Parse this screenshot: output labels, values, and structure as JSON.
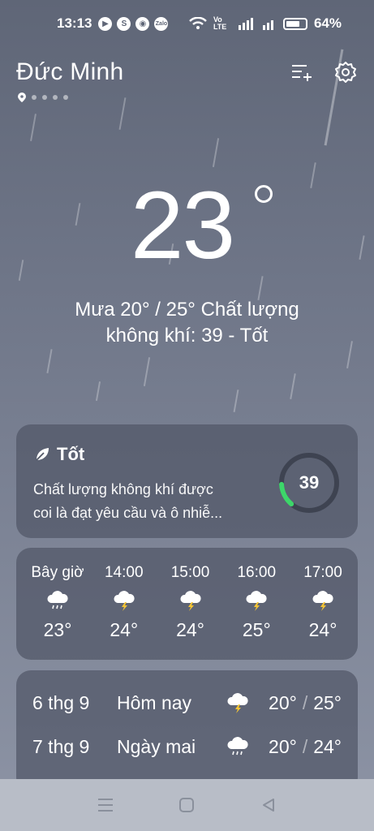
{
  "status_bar": {
    "time": "13:13",
    "battery": "64%",
    "network_label": "Vo LTE"
  },
  "header": {
    "location": "Đức Minh"
  },
  "current": {
    "temperature": "23",
    "summary_line1": "Mưa  20° / 25°  Chất lượng",
    "summary_line2": "không khí: 39 - Tốt"
  },
  "aqi": {
    "title": "Tốt",
    "description_line1": "Chất lượng không khí được",
    "description_line2": "coi là đạt yêu cầu và ô nhiễ...",
    "value": "39",
    "value_fraction": 0.13,
    "accent_color": "#3dd66a"
  },
  "hourly": [
    {
      "label": "Bây giờ",
      "icon": "rain-cloud-icon",
      "temp": "23°"
    },
    {
      "label": "14:00",
      "icon": "thunderstorm-icon",
      "temp": "24°"
    },
    {
      "label": "15:00",
      "icon": "thunderstorm-icon",
      "temp": "24°"
    },
    {
      "label": "16:00",
      "icon": "thunderstorm-icon",
      "temp": "25°"
    },
    {
      "label": "17:00",
      "icon": "thunderstorm-icon",
      "temp": "24°"
    }
  ],
  "daily": [
    {
      "date": "6 thg 9",
      "name": "Hôm nay",
      "icon": "thunderstorm-icon",
      "low": "20°",
      "high": "25°"
    },
    {
      "date": "7 thg 9",
      "name": "Ngày mai",
      "icon": "rain-cloud-icon",
      "low": "20°",
      "high": "24°"
    }
  ],
  "colors": {
    "bg_top": "#5f6677",
    "card": "#505666",
    "bolt": "#f5c534"
  }
}
